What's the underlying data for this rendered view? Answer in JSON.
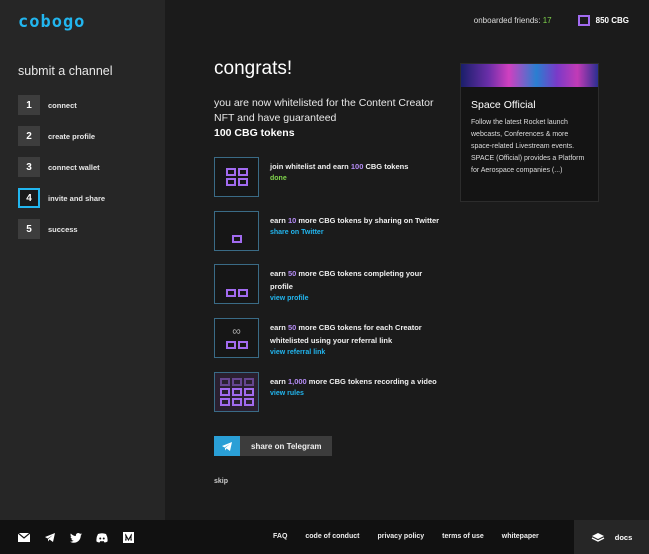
{
  "app": {
    "logo": "cobogo"
  },
  "header": {
    "friends_label": "onboarded friends:",
    "friends_count": "17",
    "balance": "850 CBG"
  },
  "sidebar": {
    "title": "submit a channel",
    "steps": [
      {
        "num": "1",
        "label": "connect"
      },
      {
        "num": "2",
        "label": "create profile"
      },
      {
        "num": "3",
        "label": "connect wallet"
      },
      {
        "num": "4",
        "label": "invite and share"
      },
      {
        "num": "5",
        "label": "success"
      }
    ]
  },
  "main": {
    "title": "congrats!",
    "intro": "you are now whitelisted for the Content Creator NFT and have guaranteed",
    "guaranteed": "100 CBG tokens",
    "tasks": [
      {
        "pre": "join whitelist and earn ",
        "amount": "100",
        "post": " CBG tokens",
        "link": "done"
      },
      {
        "pre": "earn ",
        "amount": "10",
        "post": " more CBG tokens by sharing on Twitter",
        "link": "share on Twitter"
      },
      {
        "pre": "earn ",
        "amount": "50",
        "post": " more CBG tokens completing your profile",
        "link": "view profile"
      },
      {
        "pre": "earn ",
        "amount": "50",
        "post": " more CBG tokens for each Creator whitelisted using your referral link",
        "link": "view referral link"
      },
      {
        "pre": "earn ",
        "amount": "1,000",
        "post": " more CBG tokens recording a video",
        "link": "view rules"
      }
    ],
    "telegram_button": "share on Telegram",
    "skip": "skip"
  },
  "card": {
    "title": "Space Official",
    "body": "Follow the latest Rocket launch webcasts, Conferences & more space-related Livestream events. SPACE (Official) provides a Platform for Aerospace companies (...)"
  },
  "footer": {
    "icons": [
      "email-icon",
      "telegram-icon",
      "twitter-icon",
      "discord-icon",
      "medium-icon"
    ],
    "links": [
      "FAQ",
      "code of conduct",
      "privacy policy",
      "terms of use",
      "whitepaper"
    ],
    "docs": "docs"
  },
  "colors": {
    "accent": "#22b6ef",
    "purple": "#a26bf0",
    "green": "#7fd34b"
  }
}
